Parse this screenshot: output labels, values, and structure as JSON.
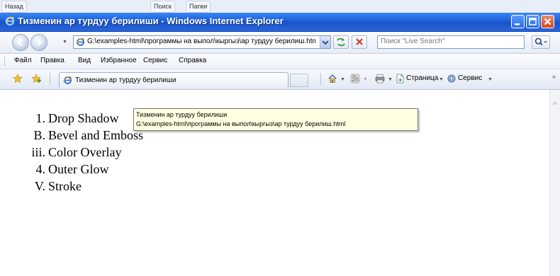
{
  "taskbar": {
    "items": [
      "Назад",
      "Поиск",
      "Папки"
    ]
  },
  "window": {
    "title": "Тизменин ар турдуу берилиши - Windows Internet Explorer",
    "titlebar_color": "#1b5fd8",
    "close_color": "#d2461c"
  },
  "address": {
    "url": "G:\\examples-html\\программы на выпол\\кыргыз\\ар турдуу берилиш.html"
  },
  "search": {
    "placeholder": "Поиск \"Live Search\""
  },
  "menu": {
    "items": [
      "Файл",
      "Правка",
      "Вид",
      "Избранное",
      "Сервис",
      "Справка"
    ]
  },
  "favorites": {
    "tab_label": "Тизменин ар турдуу берилиши",
    "commands": {
      "page": "Страница",
      "tools": "Сервис"
    }
  },
  "content": {
    "list": [
      {
        "marker": "1.",
        "text": "Drop Shadow"
      },
      {
        "marker": "B.",
        "text": "Bevel and Emboss"
      },
      {
        "marker": "iii.",
        "text": "Color Overlay"
      },
      {
        "marker": "4.",
        "text": "Outer Glow"
      },
      {
        "marker": "V.",
        "text": "Stroke"
      }
    ]
  },
  "tooltip": {
    "title": "Тизменин ар турдуу берилиши",
    "path": "G:\\examples-html\\программы на выпол\\кыргыз\\ар турдуу берилиш.html"
  },
  "icons": [
    "ie-logo-icon",
    "minimize-icon",
    "maximize-icon",
    "close-icon",
    "back-arrow-icon",
    "forward-arrow-icon",
    "page-icon",
    "refresh-icon",
    "stop-icon",
    "search-icon",
    "favorites-star-icon",
    "add-favorites-icon",
    "home-icon",
    "feeds-icon",
    "print-icon",
    "page-menu-icon",
    "tools-gear-icon",
    "scroll-up-icon"
  ]
}
